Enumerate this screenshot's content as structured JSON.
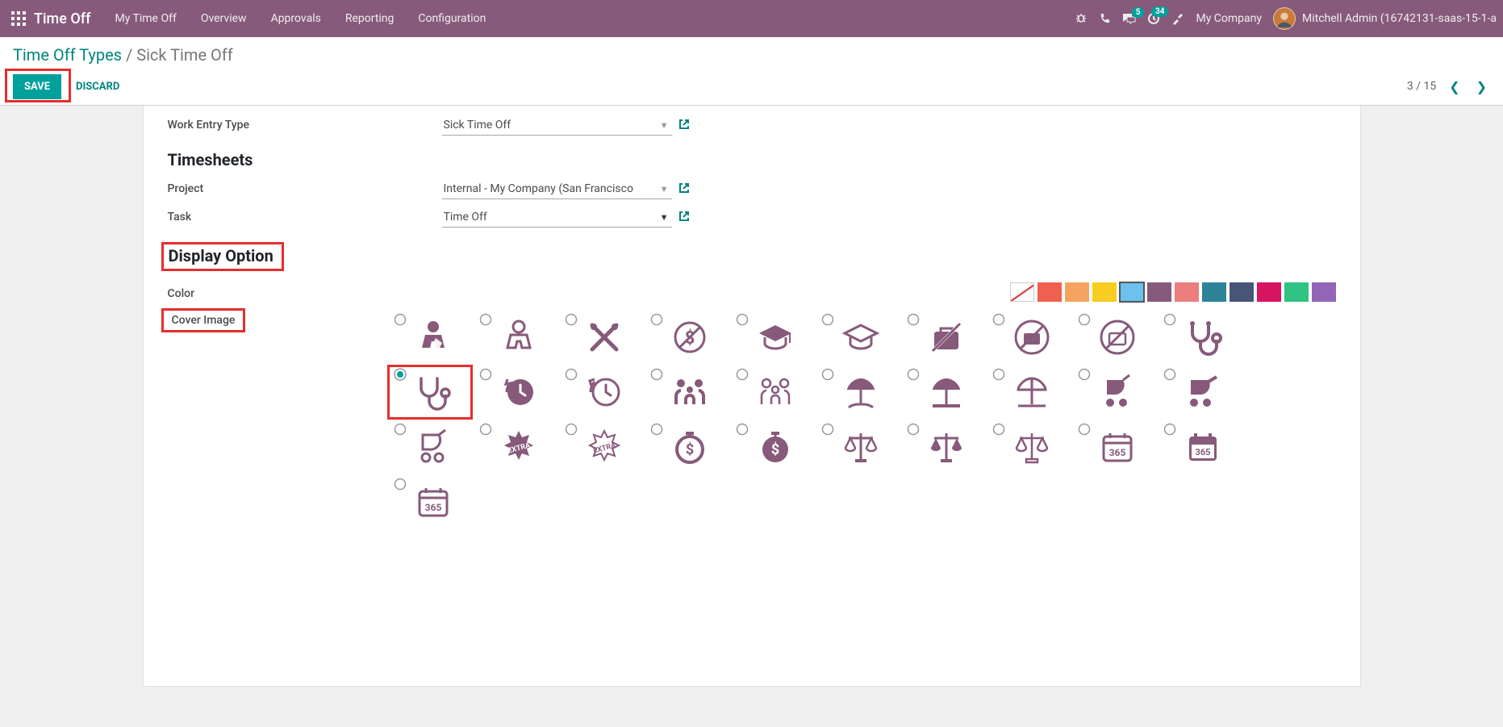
{
  "navbar": {
    "app_title": "Time Off",
    "menus": [
      "My Time Off",
      "Overview",
      "Approvals",
      "Reporting",
      "Configuration"
    ],
    "msg_badge": "5",
    "activity_badge": "34",
    "company": "My Company",
    "user": "Mitchell Admin (16742131-saas-15-1-a"
  },
  "breadcrumb": {
    "parent": "Time Off Types",
    "current": "Sick Time Off"
  },
  "buttons": {
    "save": "SAVE",
    "discard": "DISCARD"
  },
  "pager": {
    "text": "3 / 15"
  },
  "form": {
    "work_entry_type_label": "Work Entry Type",
    "work_entry_type_value": "Sick Time Off",
    "timesheets_heading": "Timesheets",
    "project_label": "Project",
    "project_value": "Internal - My Company (San Francisco",
    "task_label": "Task",
    "task_value": "Time Off",
    "display_option_heading": "Display Option",
    "color_label": "Color",
    "cover_image_label": "Cover Image"
  },
  "colors": [
    {
      "name": "none",
      "hex": "none",
      "selected": false
    },
    {
      "name": "red",
      "hex": "#f06050",
      "selected": false
    },
    {
      "name": "orange",
      "hex": "#f4a460",
      "selected": false
    },
    {
      "name": "yellow",
      "hex": "#f7cd1f",
      "selected": false
    },
    {
      "name": "lightblue",
      "hex": "#6cc1ed",
      "selected": true
    },
    {
      "name": "purple",
      "hex": "#875a7b",
      "selected": false
    },
    {
      "name": "pink",
      "hex": "#eb7e7f",
      "selected": false
    },
    {
      "name": "teal",
      "hex": "#2c8397",
      "selected": false
    },
    {
      "name": "darkblue",
      "hex": "#475577",
      "selected": false
    },
    {
      "name": "magenta",
      "hex": "#d6145f",
      "selected": false
    },
    {
      "name": "green",
      "hex": "#30c381",
      "selected": false
    },
    {
      "name": "violet",
      "hex": "#9365b8",
      "selected": false
    }
  ],
  "cover_images": [
    {
      "name": "person-arm-sling",
      "selected": false
    },
    {
      "name": "person-arm-sling-outline",
      "selected": false
    },
    {
      "name": "crossed-utensils",
      "selected": false
    },
    {
      "name": "no-dollar-circle",
      "selected": false
    },
    {
      "name": "graduation-cap",
      "selected": false
    },
    {
      "name": "graduation-cap-outline",
      "selected": false
    },
    {
      "name": "briefcase-slash",
      "selected": false
    },
    {
      "name": "no-briefcase-circle",
      "selected": false
    },
    {
      "name": "no-briefcase-circle-outline",
      "selected": false
    },
    {
      "name": "stethoscope",
      "selected": false
    },
    {
      "name": "stethoscope-alt",
      "selected": true,
      "highlighted": true
    },
    {
      "name": "clock-back",
      "selected": false
    },
    {
      "name": "clock-back-outline",
      "selected": false
    },
    {
      "name": "family",
      "selected": false
    },
    {
      "name": "family-outline",
      "selected": false
    },
    {
      "name": "beach-umbrella",
      "selected": false
    },
    {
      "name": "beach-umbrella-alt",
      "selected": false
    },
    {
      "name": "beach-umbrella-outline",
      "selected": false
    },
    {
      "name": "stroller",
      "selected": false
    },
    {
      "name": "stroller-alt",
      "selected": false
    },
    {
      "name": "stroller-outline",
      "selected": false
    },
    {
      "name": "burst-extra",
      "selected": false
    },
    {
      "name": "burst-extra-outline",
      "selected": false
    },
    {
      "name": "stopwatch-dollar",
      "selected": false
    },
    {
      "name": "stopwatch-dollar-alt",
      "selected": false
    },
    {
      "name": "scales",
      "selected": false
    },
    {
      "name": "scales-alt",
      "selected": false
    },
    {
      "name": "scales-outline",
      "selected": false
    },
    {
      "name": "calendar-365",
      "selected": false
    },
    {
      "name": "calendar-365-alt",
      "selected": false
    },
    {
      "name": "calendar-365-outline",
      "selected": false
    }
  ]
}
